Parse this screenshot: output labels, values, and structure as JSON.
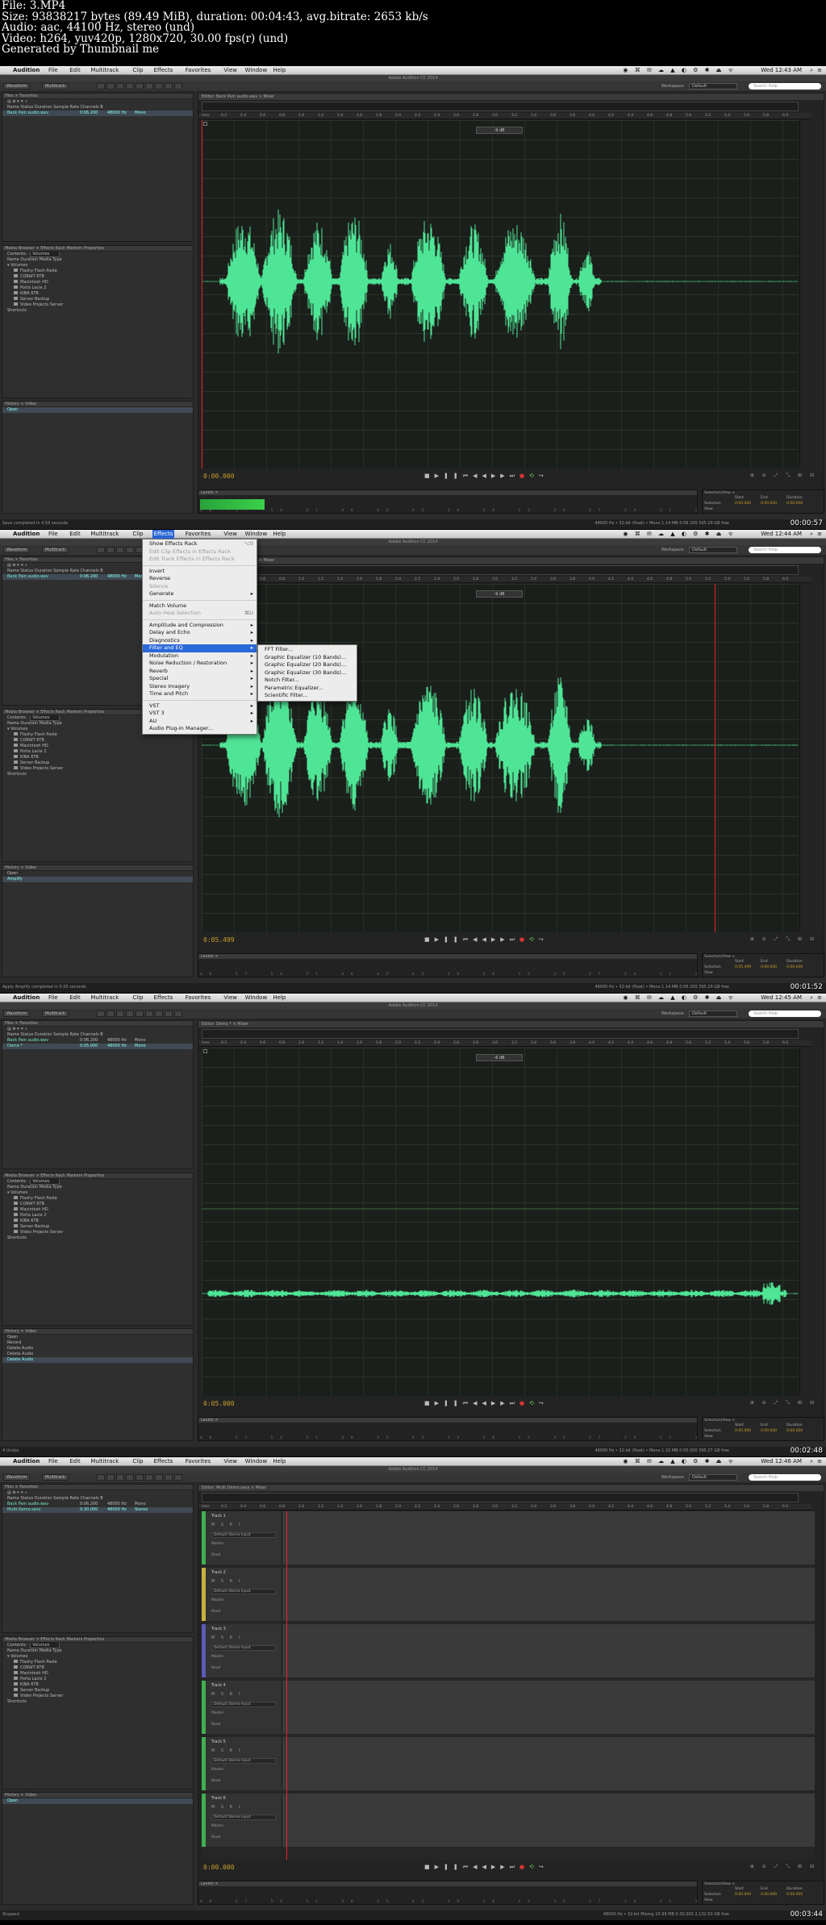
{
  "header": {
    "lines": [
      "File: 3.MP4",
      "Size: 93838217 bytes (89.49 MiB), duration: 00:04:43, avg.bitrate: 2653 kb/s",
      "Audio: aac, 44100 Hz, stereo (und)",
      "Video: h264, yuv420p, 1280x720, 30.00 fps(r) (und)",
      "Generated by Thumbnail me"
    ]
  },
  "app": {
    "window_title": "Adobe Audition CC 2014",
    "app_name": "Audition",
    "menus": [
      "File",
      "Edit",
      "Multitrack",
      "Clip",
      "Effects",
      "Favorites",
      "View",
      "Window",
      "Help"
    ],
    "workspace_label": "Workspace:",
    "workspace": "Default",
    "search_placeholder": "Search Help",
    "mode_buttons": [
      "Waveform",
      "Multitrack"
    ]
  },
  "panels": {
    "files_tabs": "Files ×   Favorites",
    "media_tabs": "Media Browser ×   Effects Rack   Markers   Properties",
    "media_contents_label": "Contents:",
    "media_contents_value": "Volumes",
    "history_tabs": "History ×   Video",
    "media_columns": "Name                       Duration    Media Type",
    "file_columns": "Name                Status   Duration   Sample Rate   Channels   B",
    "volumes": [
      "Flashy Flash Paste",
      "CORAIT 6TB",
      "Macintosh HD",
      "Porta Lacie 2",
      "KIBA 6TB",
      "Server Backup",
      "Video Projects Server"
    ],
    "shortcuts": "Shortcuts"
  },
  "frames": [
    {
      "stamp": "00:00:57",
      "editor_tab": "Editor: Back Pain audio.wav ×     Mixer",
      "files": [
        {
          "name": "Back Pain audio.wav",
          "dur": "0:06.200",
          "rate": "48000 Hz",
          "ch": "Mono"
        }
      ],
      "history": [
        "Open"
      ],
      "time": "0:00.000",
      "status_left": "Save completed in 4.59 seconds",
      "status_right": "48000 Hz • 32-bit (float) • Mono     1.14 MB     0:06.200     395.29 GB free",
      "level_db": "-9 dB",
      "selection": {
        "start": "0:00.000",
        "end": "0:00.000",
        "dur": "0:00.000"
      }
    },
    {
      "stamp": "00:01:52",
      "editor_tab": "Editor: Back Pain audio.wav ×     Mixer",
      "files": [
        {
          "name": "Back Pain audio.wav",
          "dur": "0:06.200",
          "rate": "48000 Hz",
          "ch": "Mono"
        }
      ],
      "history": [
        "Open",
        "Amplify"
      ],
      "time": "0:05.499",
      "status_left": "Apply Amplify completed in 0.05 seconds",
      "status_right": "48000 Hz • 32-bit (float) • Mono     1.14 MB     0:06.200     395.29 GB free",
      "level_db": "-9 dB",
      "selection": {
        "start": "0:05.499",
        "end": "0:00.000",
        "dur": "0:00.000"
      },
      "menu": {
        "items": [
          {
            "l": "Show Effects Rack",
            "k": "⌥0"
          },
          {
            "l": "Edit Clip Effects in Effects Rack",
            "d": true
          },
          {
            "l": "Edit Track Effects in Effects Rack",
            "d": true
          },
          {
            "sep": true
          },
          {
            "l": "Invert"
          },
          {
            "l": "Reverse"
          },
          {
            "l": "Silence",
            "d": true
          },
          {
            "l": "Generate",
            "a": true
          },
          {
            "sep": true
          },
          {
            "l": "Match Volume"
          },
          {
            "l": "Auto Heal Selection",
            "d": true,
            "k": "⌘U"
          },
          {
            "sep": true
          },
          {
            "l": "Amplitude and Compression",
            "a": true
          },
          {
            "l": "Delay and Echo",
            "a": true
          },
          {
            "l": "Diagnostics",
            "a": true
          },
          {
            "l": "Filter and EQ",
            "a": true,
            "h": true
          },
          {
            "l": "Modulation",
            "a": true
          },
          {
            "l": "Noise Reduction / Restoration",
            "a": true
          },
          {
            "l": "Reverb",
            "a": true
          },
          {
            "l": "Special",
            "a": true
          },
          {
            "l": "Stereo Imagery",
            "a": true
          },
          {
            "l": "Time and Pitch",
            "a": true
          },
          {
            "sep": true
          },
          {
            "l": "VST",
            "a": true
          },
          {
            "l": "VST 3",
            "a": true
          },
          {
            "l": "AU",
            "a": true
          },
          {
            "l": "Audio Plug-In Manager..."
          }
        ],
        "submenu": [
          "FFT Filter...",
          "Graphic Equalizer (10 Bands)...",
          "Graphic Equalizer (20 Bands)...",
          "Graphic Equalizer (30 Bands)...",
          "Notch Filter...",
          "Parametric Equalizer...",
          "Scientific Filter..."
        ]
      }
    },
    {
      "stamp": "00:02:48",
      "editor_tab": "Editor: Demo * ×     Mixer",
      "files": [
        {
          "name": "Back Pain audio.wav",
          "dur": "0:06.200",
          "rate": "48000 Hz",
          "ch": "Mono"
        },
        {
          "name": "Demo *",
          "dur": "0:05.000",
          "rate": "48000 Hz",
          "ch": "Mono"
        }
      ],
      "history": [
        "Open",
        "Record",
        "Delete Audio",
        "Delete Audio",
        "Delete Audio"
      ],
      "time": "0:05.000",
      "status_left": "4 Undos",
      "status_right": "48000 Hz • 32-bit (float) • Mono     1.33 MB     0:05.000     395.27 GB free",
      "level_db": "-6 dB",
      "selection": {
        "start": "0:05.000",
        "end": "0:00.000",
        "dur": "0:00.000"
      }
    },
    {
      "stamp": "00:03:44",
      "editor_tab": "Editor: Multi Demo.sesx ×     Mixer",
      "files": [
        {
          "name": "Back Pain audio.wav",
          "dur": "0:06.200",
          "rate": "48000 Hz",
          "ch": "Mono"
        },
        {
          "name": "Multi Demo.sesx",
          "dur": "0:30.000",
          "rate": "48000 Hz",
          "ch": "Stereo"
        }
      ],
      "history": [
        "Open"
      ],
      "time": "0:00.000",
      "status_left": "Stopped",
      "status_right": "48000 Hz • 32-bit Mixing     10.99 MB     0:30.000     2,132.50 GB free",
      "level_db": "",
      "selection": {
        "start": "0:00.000",
        "end": "0:00.000",
        "dur": "0:00.000"
      },
      "tracks": [
        {
          "name": "Track 1",
          "color": "#3fb04f"
        },
        {
          "name": "Track 2",
          "color": "#c8b040"
        },
        {
          "name": "Track 3",
          "color": "#5a5ab8"
        },
        {
          "name": "Track 4",
          "color": "#3fb04f"
        },
        {
          "name": "Track 5",
          "color": "#3fb04f"
        },
        {
          "name": "Track 6",
          "color": "#3fb04f"
        }
      ],
      "track_input": "Default Stereo Input",
      "track_read": "Read",
      "track_master": "Master"
    }
  ],
  "system": {
    "clocks": [
      "Wed 12:43 AM",
      "Wed 12:44 AM",
      "Wed 12:45 AM",
      "Wed 12:46 AM"
    ],
    "user_glyph": "≡",
    "battery": "10"
  },
  "transport": [
    "■",
    "▶",
    "❚❚",
    "⏮",
    "◀◀",
    "▶▶",
    "⏭",
    "●",
    "⟲",
    "↪"
  ],
  "selview": {
    "title": "Selection/View ×",
    "cols": [
      "Start",
      "End",
      "Duration"
    ],
    "rows": [
      "Selection",
      "View"
    ]
  },
  "colors": {
    "waveform": "#4fe596",
    "accent": "#2b68d8",
    "time": "#c8a02a"
  },
  "ruler_ticks": [
    "hms",
    "0.2",
    "0.4",
    "0.6",
    "0.8",
    "1.0",
    "1.2",
    "1.4",
    "1.6",
    "1.8",
    "2.0",
    "2.2",
    "2.4",
    "2.6",
    "2.8",
    "3.0",
    "3.2",
    "3.4",
    "3.6",
    "3.8",
    "4.0",
    "4.2",
    "4.4",
    "4.6",
    "4.8",
    "5.0",
    "5.2",
    "5.4",
    "5.6",
    "5.8",
    "6.0"
  ],
  "levels_scale": [
    "dB",
    "-57",
    "-54",
    "-51",
    "-48",
    "-45",
    "-42",
    "-39",
    "-36",
    "-33",
    "-30",
    "-27",
    "-24",
    "-21",
    "-18",
    "-15",
    "-12",
    "-9",
    "-6",
    "-3",
    "0"
  ],
  "level_fill": [
    0.13,
    0.0,
    0.0,
    0.0
  ]
}
